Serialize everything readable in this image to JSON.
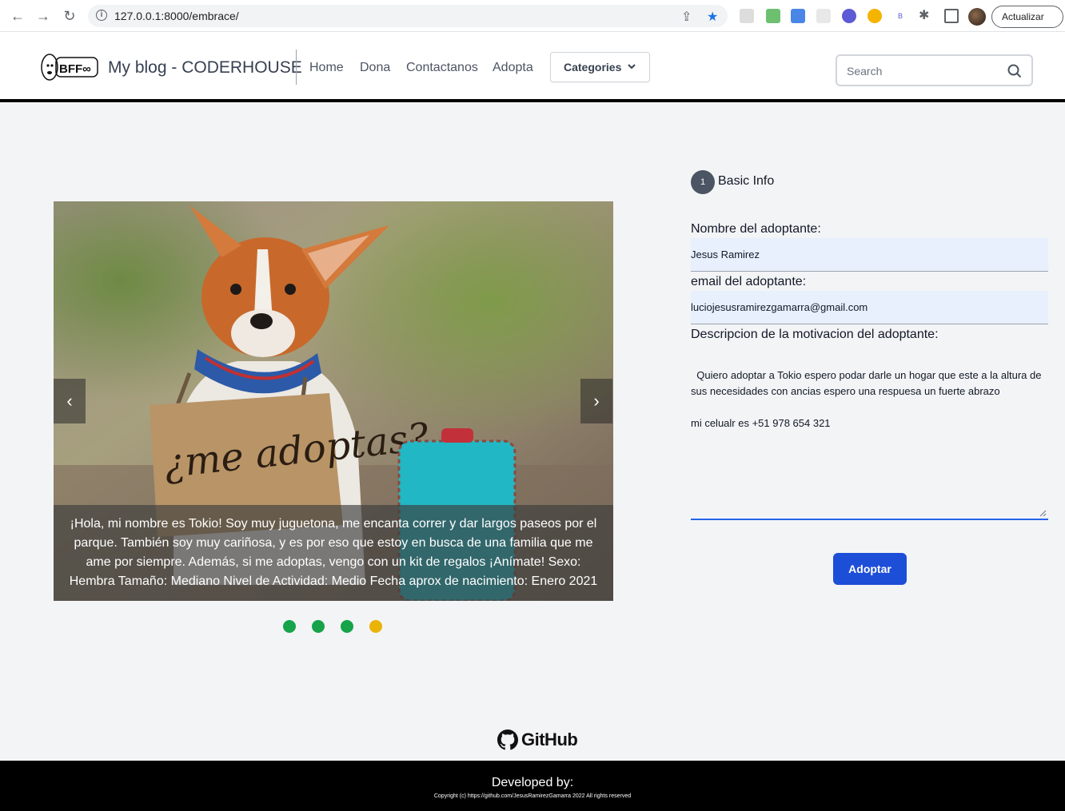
{
  "browser": {
    "url": "127.0.0.1:8000/embrace/",
    "update_button": "Actualizar",
    "icons": [
      "back-icon",
      "forward-icon",
      "reload-icon",
      "site-info-icon",
      "share-icon",
      "bookmark-star-icon",
      "extensions-icon",
      "sidebar-icon"
    ]
  },
  "header": {
    "brand": "My blog - CODERHOUSE",
    "logo_text": "BFF∞",
    "nav": [
      "Home",
      "Dona",
      "Contactanos",
      "Adopta"
    ],
    "categories_label": "Categories",
    "search_placeholder": "Search"
  },
  "carousel": {
    "caption": "¡Hola, mi nombre es Tokio! Soy muy juguetona, me encanta correr y dar largos paseos por el parque. También soy muy cariñosa, y es por eso que estoy en busca de una familia que me ame por siempre. Además, si me adoptas, vengo con un kit de regalos ¡Anímate! Sexo: Hembra Tamaño: Mediano Nivel de Actividad: Medio Fecha aprox de nacimiento: Enero 2021",
    "sign_text": "¿me adoptas?",
    "prev_label": "‹",
    "next_label": "›",
    "dots": [
      {
        "color": "#16a34a"
      },
      {
        "color": "#16a34a"
      },
      {
        "color": "#16a34a"
      },
      {
        "color": "#eab308"
      }
    ]
  },
  "form": {
    "step_number": "1",
    "step_label": "Basic Info",
    "name_label": "Nombre del adoptante:",
    "name_value": "Jesus Ramirez",
    "email_label": "email del adoptante:",
    "email_value": "luciojesusramirezgamarra@gmail.com",
    "motivation_label": "Descripcion de la motivacion del adoptante:",
    "motivation_value": "Quiero adoptar a Tokio espero podar darle un hogar que este a la altura de sus necesidades con ancias espero una respuesa un fuerte abrazo\n\nmi celualr es +51 978 654 321",
    "submit_label": "Adoptar"
  },
  "footer": {
    "github_label": "GitHub",
    "developed_by": "Developed by:",
    "copyright": "Copyright (c) https://github.com/JesusRamirezGamarra 2022 All rights reserved"
  },
  "colors": {
    "accent": "#1d4ed8",
    "header_border": "#000000",
    "footer_bg": "#000000"
  }
}
